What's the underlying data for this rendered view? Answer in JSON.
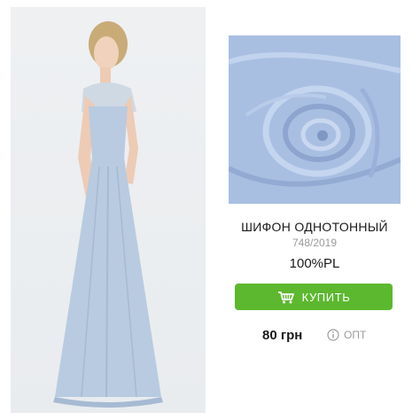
{
  "product": {
    "title": "ШИФОН ОДНОТОННЫЙ",
    "code": "748/2019",
    "composition": "100%PL",
    "buy_label": "КУПИТЬ",
    "price": "80 грн",
    "wholesale_label": "ОПТ"
  },
  "icons": {
    "buy": "basket-icon",
    "wholesale": "info-circle-icon"
  },
  "colors": {
    "accent": "#5cb82f",
    "fabric": "#a9bfe2",
    "dress": "#b9cbe0"
  }
}
